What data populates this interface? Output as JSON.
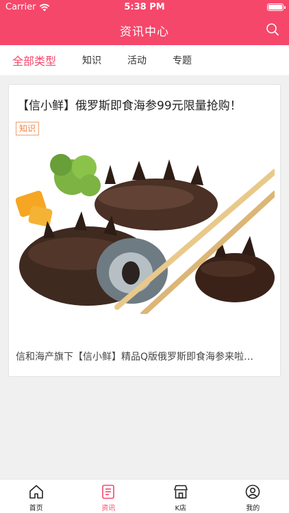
{
  "status_bar": {
    "carrier": "Carrier",
    "time": "5:38 PM"
  },
  "header": {
    "title": "资讯中心",
    "search_icon": "search-icon"
  },
  "tabs": [
    {
      "label": "全部类型",
      "active": true
    },
    {
      "label": "知识",
      "active": false
    },
    {
      "label": "活动",
      "active": false
    },
    {
      "label": "专题",
      "active": false
    }
  ],
  "article": {
    "title": "【信小鲜】俄罗斯即食海参99元限量抢购！",
    "tag": "知识",
    "summary": "信和海产旗下【信小鲜】精品Q版俄罗斯即食海参来啦…"
  },
  "tabbar": [
    {
      "label": "首页",
      "icon": "home-icon"
    },
    {
      "label": "资讯",
      "icon": "news-icon",
      "active": true
    },
    {
      "label": "K店",
      "icon": "shop-icon"
    },
    {
      "label": "我的",
      "icon": "profile-icon"
    }
  ],
  "colors": {
    "accent": "#f5476a",
    "tag": "#f08040"
  }
}
